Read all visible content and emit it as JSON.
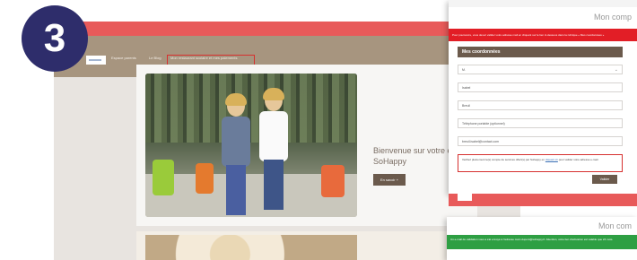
{
  "step": {
    "number": "3"
  },
  "site": {
    "nav_items": [
      {
        "label": "Espace parents"
      },
      {
        "label": "Le Blog"
      },
      {
        "label": "Mon restaurant scolaire et mes paiements"
      }
    ],
    "welcome_text": "Bienvenue sur votre espace SoHappy",
    "ensavoir_label": "En savoir +"
  },
  "modal_register": {
    "title": "Mon comp",
    "alert_text": "Pour poursuivre, vous devez valider votre adresse mail en cliquant sur le lien ci-dessous dans la rubrique « Mes coordonnées »",
    "form_title": "Mes coordonnées",
    "fields": [
      {
        "value": "M.",
        "has_chevron": true
      },
      {
        "value": "Isabel",
        "has_chevron": false
      },
      {
        "value": "Breuil",
        "has_chevron": false
      },
      {
        "value": "Téléphone portable (optionnel)",
        "has_chevron": false
      },
      {
        "value": "breuil.isabel@contact.com",
        "has_chevron": false
      }
    ],
    "notice_text": "Vérifiez pleinement le(s) compte de services offert(s) par Sohappy en",
    "notice_link": "cliquant ici",
    "notice_suffix": "pour valider votre adresse e-mail.",
    "submit_label": "Valider"
  },
  "modal_success": {
    "title": "Mon com",
    "success_text": "Un e-mail de validation vous a été envoyé à l'adresse marc.dupont@sohappy.fr. Attention, votre lien d'activation est valable que 24 mois."
  },
  "colors": {
    "accent_red": "#e85a5a",
    "nav_brown": "#a7957f",
    "button_brown": "#6b5a4c",
    "badge_navy": "#2e2d6b",
    "success_green": "#2e9f43"
  }
}
